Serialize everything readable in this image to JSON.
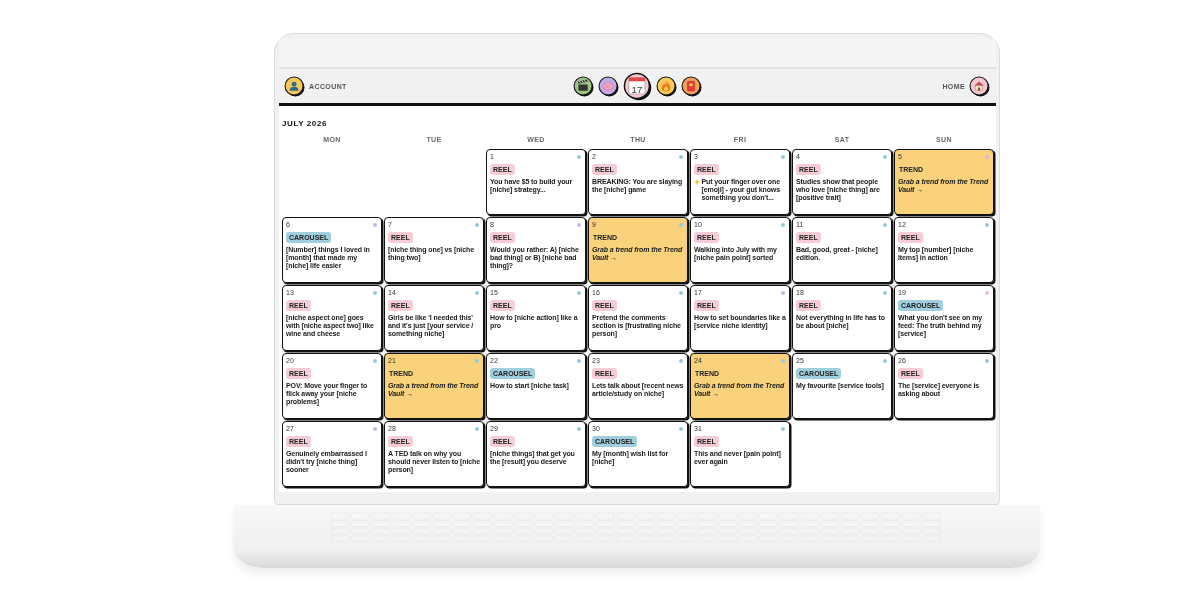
{
  "nav": {
    "account": {
      "label": "ACCOUNT"
    },
    "icons": [
      {
        "kind": "clapperboard",
        "selected": false
      },
      {
        "kind": "brain",
        "selected": false
      },
      {
        "kind": "calendar",
        "selected": true,
        "date": "17"
      },
      {
        "kind": "flame",
        "selected": false
      },
      {
        "kind": "book",
        "selected": false
      }
    ],
    "home": {
      "label": "HOME"
    }
  },
  "calendar": {
    "title": "JULY 2026",
    "weekdays": [
      "MON",
      "TUE",
      "WED",
      "THU",
      "FRI",
      "SAT",
      "SUN"
    ],
    "weeks": [
      {
        "days": [
          {
            "date": "1",
            "kind": "reel",
            "tag": "REEL",
            "text": "You have $5 to build your [niche] strategy...",
            "color": "#93cce0"
          },
          {
            "date": "2",
            "kind": "reel",
            "tag": "REEL",
            "text": "BREAKING: You are slaying the [niche] game",
            "color": "#93cce0"
          },
          {
            "date": "3",
            "kind": "reel",
            "tag": "REEL",
            "text": "Put your finger over one [emoji] - your gut knows something you don't...",
            "color": "#93cce0"
          },
          {
            "date": "4",
            "kind": "reel",
            "tag": "REEL",
            "text": "Studies show that people who love [niche thing] are [positive trait]",
            "color": "#93cce0"
          },
          {
            "date": "5",
            "kind": "trend",
            "tag": "TREND",
            "text": "Grab a trend from the Trend Vault →",
            "color": "#d6b4e3"
          }
        ]
      },
      {
        "days": [
          {
            "date": "6",
            "kind": "carousel",
            "tag": "CAROUSEL",
            "text": "[Number] things I loved in [month] that made my [niche] life easier",
            "color": "#cdb3e6"
          },
          {
            "date": "7",
            "kind": "reel",
            "tag": "REEL",
            "text": "[niche thing one] vs [niche thing two]",
            "color": "#93cce0"
          },
          {
            "date": "8",
            "kind": "reel",
            "tag": "REEL",
            "text": "Would you rather: A) [niche bad thing] or B) [niche bad thing]?",
            "color": "#cdb3e6"
          },
          {
            "date": "9",
            "kind": "trend",
            "tag": "TREND",
            "text": "Grab a trend from the Trend Vault →",
            "color": "#93cce0"
          },
          {
            "date": "10",
            "kind": "reel",
            "tag": "REEL",
            "text": "Walking into July with my [niche pain point] sorted",
            "color": "#93cce0"
          },
          {
            "date": "11",
            "kind": "reel",
            "tag": "REEL",
            "text": "Bad, good, great - [niche] edition.",
            "color": "#93cce0"
          },
          {
            "date": "12",
            "kind": "reel",
            "tag": "REEL",
            "text": "My top [number] [niche items] in action",
            "color": "#93cce0"
          }
        ]
      },
      {
        "days": [
          {
            "date": "13",
            "kind": "reel",
            "tag": "REEL",
            "text": "[niche aspect one] goes with [niche aspect two] like wine and cheese",
            "color": "#93cce0"
          },
          {
            "date": "14",
            "kind": "reel",
            "tag": "REEL",
            "text": "Girls be like 'I needed this' and it's just [your service / something niche]",
            "color": "#93cce0"
          },
          {
            "date": "15",
            "kind": "reel",
            "tag": "REEL",
            "text": "How to [niche action] like a pro",
            "color": "#93cce0"
          },
          {
            "date": "16",
            "kind": "reel",
            "tag": "REEL",
            "text": "Pretend the comments section is [frustrating niche person]",
            "color": "#93cce0"
          },
          {
            "date": "17",
            "kind": "reel",
            "tag": "REEL",
            "text": "How to set boundaries like a [service niche identity]",
            "color": "#cdb3e6"
          },
          {
            "date": "18",
            "kind": "reel",
            "tag": "REEL",
            "text": "Not everything in life has to be about [niche]",
            "color": "#93cce0"
          },
          {
            "date": "19",
            "kind": "carousel",
            "tag": "CAROUSEL",
            "text": "What you don't see on my feed: The truth behind my [service]",
            "color": "#f3b9c6"
          }
        ]
      },
      {
        "days": [
          {
            "date": "20",
            "kind": "reel",
            "tag": "REEL",
            "text": "POV: Move your finger to flick away your [niche problems]",
            "color": "#93cce0"
          },
          {
            "date": "21",
            "kind": "trend",
            "tag": "TREND",
            "text": "Grab a trend from the Trend Vault →",
            "color": "#93cce0"
          },
          {
            "date": "22",
            "kind": "carousel",
            "tag": "CAROUSEL",
            "text": "How to start [niche task]",
            "color": "#93cce0"
          },
          {
            "date": "23",
            "kind": "reel",
            "tag": "REEL",
            "text": "Lets talk about [recent news article/study on niche]",
            "color": "#93cce0"
          },
          {
            "date": "24",
            "kind": "trend",
            "tag": "TREND",
            "text": "Grab a trend from the Trend Vault →",
            "color": "#93cce0"
          },
          {
            "date": "25",
            "kind": "carousel",
            "tag": "CAROUSEL",
            "text": "My favourite [service tools]",
            "color": "#93cce0"
          },
          {
            "date": "26",
            "kind": "reel",
            "tag": "REEL",
            "text": "The [service] everyone is asking about",
            "color": "#93cce0"
          }
        ]
      },
      {
        "days": [
          {
            "date": "27",
            "kind": "reel",
            "tag": "REEL",
            "text": "Genuinely embarrassed I didn't try [niche thing] sooner",
            "color": "#cdb3e6"
          },
          {
            "date": "28",
            "kind": "reel",
            "tag": "REEL",
            "text": "A TED talk on why you should never listen to [niche person]",
            "color": "#93cce0"
          },
          {
            "date": "29",
            "kind": "reel",
            "tag": "REEL",
            "text": "[niche things] that get you the [result] you deserve",
            "color": "#93cce0"
          },
          {
            "date": "30",
            "kind": "carousel",
            "tag": "CAROUSEL",
            "text": "My [month] wish list for [niche]",
            "color": "#93cce0"
          },
          {
            "date": "31",
            "kind": "reel",
            "tag": "REEL",
            "text": "This and never [pain point] ever again",
            "color": "#93cce0"
          }
        ]
      }
    ]
  }
}
